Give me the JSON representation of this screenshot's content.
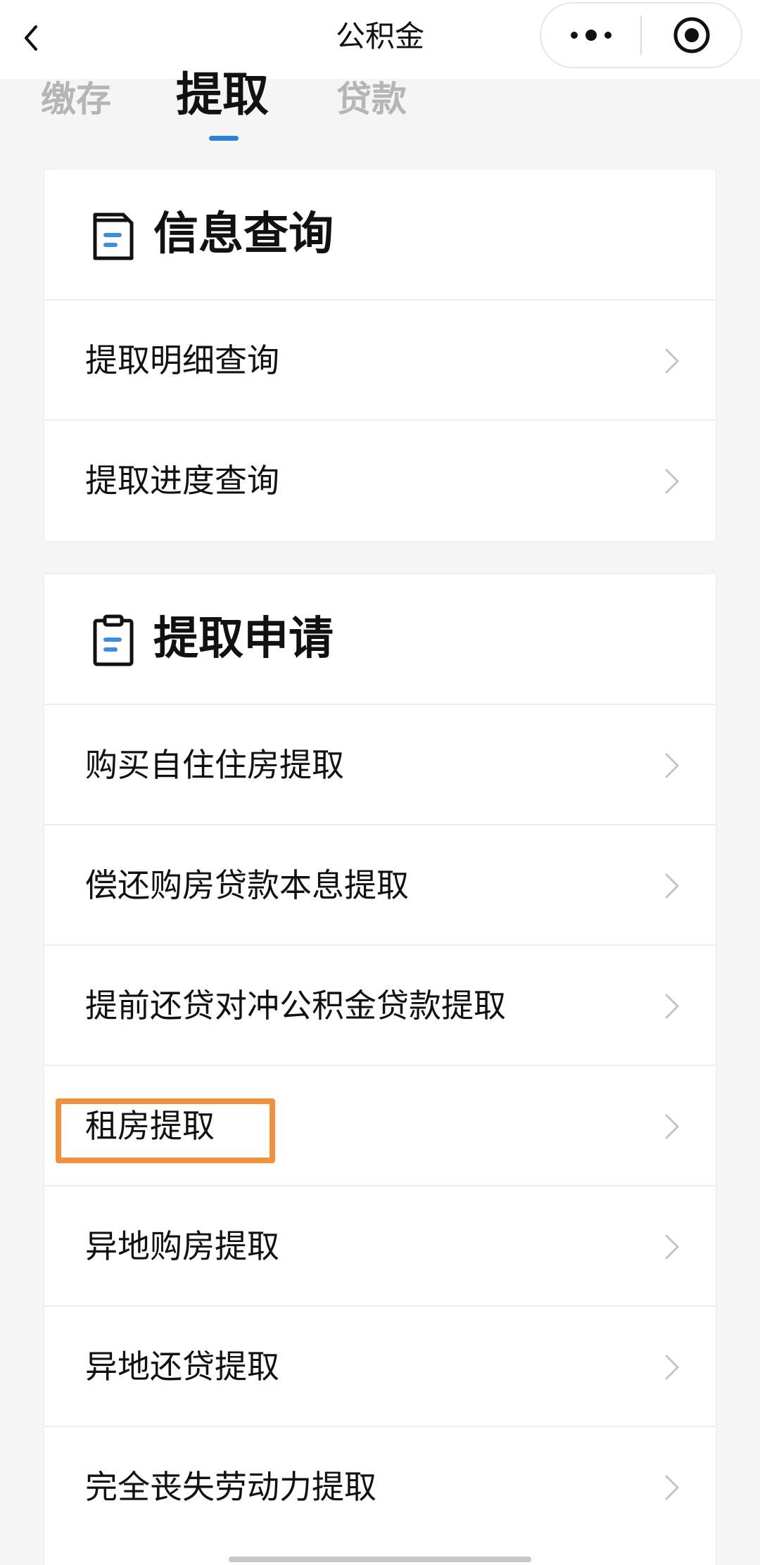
{
  "navbar": {
    "title": "公积金",
    "back_icon": "chevron-left-icon",
    "more_icon": "more-dots-icon",
    "close_icon": "target-icon"
  },
  "tabs": [
    {
      "label": "缴存",
      "active": false
    },
    {
      "label": "提取",
      "active": true
    },
    {
      "label": "贷款",
      "active": false
    }
  ],
  "info_section": {
    "title": "信息查询",
    "icon": "document-icon",
    "items": [
      {
        "label": "提取明细查询"
      },
      {
        "label": "提取进度查询"
      }
    ]
  },
  "apply_section": {
    "title": "提取申请",
    "icon": "clipboard-icon",
    "items": [
      {
        "label": "购买自住住房提取"
      },
      {
        "label": "偿还购房贷款本息提取"
      },
      {
        "label": "提前还贷对冲公积金贷款提取"
      },
      {
        "label": "租房提取",
        "highlighted": true
      },
      {
        "label": "异地购房提取"
      },
      {
        "label": "异地还贷提取"
      },
      {
        "label": "完全丧失劳动力提取"
      }
    ]
  },
  "colors": {
    "accent": "#2f7fd6",
    "highlight": "#f5903a",
    "background": "#f5f5f5"
  }
}
